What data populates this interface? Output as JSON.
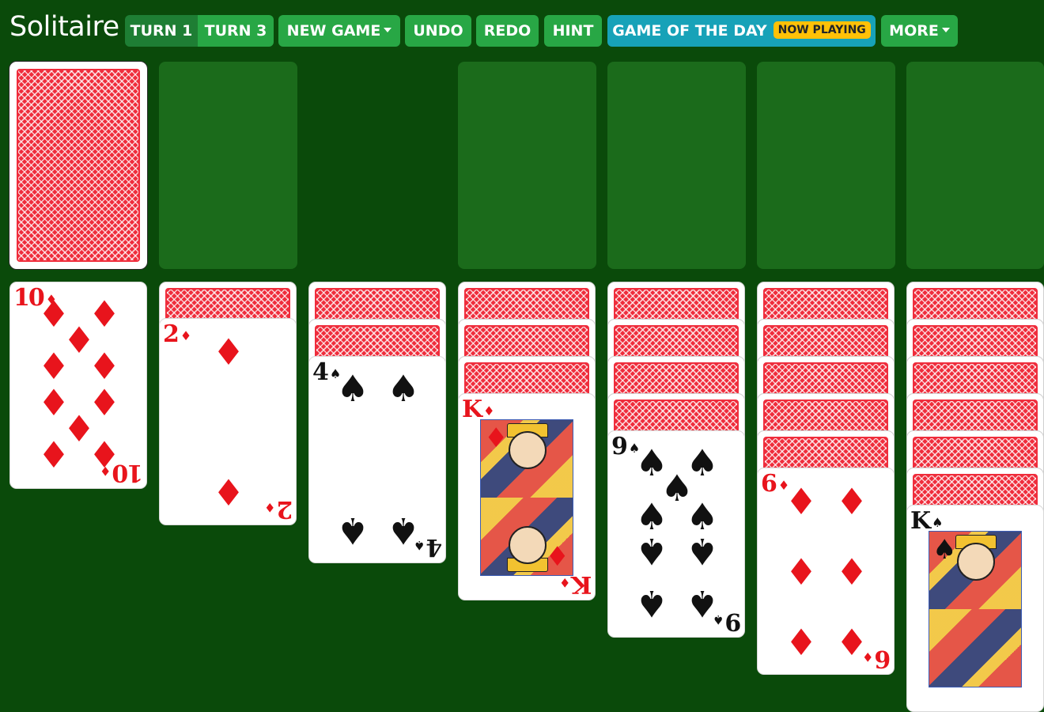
{
  "app": {
    "title": "Solitaire"
  },
  "toolbar": {
    "turn1_label": "TURN 1",
    "turn3_label": "TURN 3",
    "new_game_label": "NEW GAME",
    "undo_label": "UNDO",
    "redo_label": "REDO",
    "hint_label": "HINT",
    "game_of_day_label": "GAME OF THE DAY",
    "now_playing_badge": "NOW PLAYING",
    "more_label": "MORE",
    "active_turn_mode": "TURN 1"
  },
  "colors": {
    "table_green": "#0a4a0a",
    "slot_green": "#1b6b1b",
    "button_green": "#28a745",
    "button_active": "#1e7e34",
    "button_teal": "#17a2b8",
    "badge_yellow": "#ffc107",
    "card_red": "#e8141c",
    "card_back_red": "#ef2d3c"
  },
  "stock": {
    "face_down": true
  },
  "waste": {
    "empty": true
  },
  "foundations": [
    {
      "empty": true
    },
    {
      "empty": true
    },
    {
      "empty": true
    },
    {
      "empty": true
    }
  ],
  "tableau": [
    {
      "face_down_count": 0,
      "face_up": [
        {
          "rank": "10",
          "suit": "♦",
          "color": "red"
        }
      ]
    },
    {
      "face_down_count": 1,
      "face_up": [
        {
          "rank": "2",
          "suit": "♦",
          "color": "red"
        }
      ]
    },
    {
      "face_down_count": 2,
      "face_up": [
        {
          "rank": "4",
          "suit": "♠",
          "color": "black"
        }
      ]
    },
    {
      "face_down_count": 3,
      "face_up": [
        {
          "rank": "K",
          "suit": "♦",
          "color": "red"
        }
      ]
    },
    {
      "face_down_count": 4,
      "face_up": [
        {
          "rank": "9",
          "suit": "♠",
          "color": "black"
        }
      ]
    },
    {
      "face_down_count": 5,
      "face_up": [
        {
          "rank": "6",
          "suit": "♦",
          "color": "red"
        }
      ]
    },
    {
      "face_down_count": 6,
      "face_up": [
        {
          "rank": "K",
          "suit": "♠",
          "color": "black"
        }
      ]
    }
  ]
}
